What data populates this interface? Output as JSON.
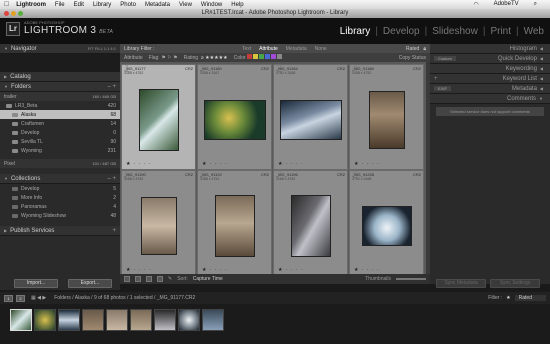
{
  "menubar": {
    "app": "Lightroom",
    "items": [
      "File",
      "Edit",
      "Library",
      "Photo",
      "Metadata",
      "View",
      "Window",
      "Help"
    ],
    "right_label": "AdobeTV"
  },
  "window": {
    "title": "LR#1TEST.lrcat - Adobe Photoshop Lightroom - Library"
  },
  "brand": {
    "logo": "Lr",
    "sub": "ADOBE PHOTOSHOP",
    "name": "LIGHTROOM 3",
    "beta": "BETA"
  },
  "modules": [
    "Library",
    "Develop",
    "Slideshow",
    "Print",
    "Web"
  ],
  "left_panel": {
    "navigator": {
      "label": "Navigator",
      "zoom": "FIT  FILL  1:1  4:1"
    },
    "catalog": {
      "label": "Catalog"
    },
    "folders": {
      "label": "Folders",
      "volume": {
        "name": "trailer",
        "size": "160 / 465 GB"
      },
      "items": [
        {
          "name": "LR3_Beta",
          "count": "420",
          "selected": false
        },
        {
          "name": "Alaska",
          "count": "68",
          "selected": true
        },
        {
          "name": "Craftsmen",
          "count": "14",
          "selected": false
        },
        {
          "name": "Develop",
          "count": "0",
          "selected": false
        },
        {
          "name": "Sevilla TL",
          "count": "90",
          "selected": false
        },
        {
          "name": "Wyoming",
          "count": "231",
          "selected": false
        }
      ],
      "volume2": {
        "name": "Pixel",
        "size": "101 / 487 GB"
      }
    },
    "collections": {
      "label": "Collections",
      "items": [
        {
          "name": "Develop",
          "count": "5"
        },
        {
          "name": "More Info",
          "count": "2"
        },
        {
          "name": "Panoramas",
          "count": "4"
        },
        {
          "name": "Wyoming Slideshow",
          "count": "48"
        }
      ]
    },
    "publish": {
      "label": "Publish Services"
    },
    "buttons": {
      "import": "Import...",
      "export": "Export..."
    }
  },
  "filter": {
    "title": "Library Filter :",
    "tabs": [
      "Text",
      "Attribute",
      "Metadata",
      "None"
    ],
    "preset": "Rated",
    "row": {
      "attribute": "Attribute",
      "flag": "Flag",
      "rating": "Rating",
      "color": "Color",
      "copy": "Copy Status"
    },
    "colors": [
      "#c43c3c",
      "#d8c43c",
      "#4aa44a",
      "#4a6ad8",
      "#a44ad8",
      "#888888"
    ]
  },
  "grid": {
    "cells": [
      {
        "num": "1",
        "name": "_MG_91177",
        "ext": "CR2",
        "size": "3168 x 4752",
        "stars": "★ · · · ·",
        "selected": true
      },
      {
        "num": "2",
        "name": "_MG_91180",
        "ext": "CR2",
        "size": "3168 x 3167",
        "stars": "★ · · · ·",
        "selected": false
      },
      {
        "num": "3",
        "name": "_MG_91184",
        "ext": "CR2",
        "size": "4752 x 3168",
        "stars": "★ · · · ·",
        "selected": false
      },
      {
        "num": "4",
        "name": "_MG_91188",
        "ext": "CR2",
        "size": "3168 x 4752",
        "stars": "★ · · · ·",
        "selected": false
      },
      {
        "num": "5",
        "name": "_MG_91190",
        "ext": "CR2",
        "size": "3168 x 4752",
        "stars": "★ · · · ·",
        "selected": false
      },
      {
        "num": "6",
        "name": "_MG_91192",
        "ext": "CR2",
        "size": "3168 x 4752",
        "stars": "★ · · · ·",
        "selected": false
      },
      {
        "num": "7",
        "name": "_MG_91196",
        "ext": "CR2",
        "size": "3168 x 4752",
        "stars": "★ · · · ·",
        "selected": false
      },
      {
        "num": "8",
        "name": "_MG_91205",
        "ext": "CR2",
        "size": "4752 x 3168",
        "stars": "★ · · · ·",
        "selected": false
      }
    ]
  },
  "toolbar": {
    "sort_label": "Sort:",
    "sort_value": "Capture Time",
    "thumbs": "Thumbnails"
  },
  "right_panel": {
    "histogram": "Histogram",
    "quick_develop": {
      "label": "Quick Develop",
      "preset": "Custom"
    },
    "keywording": "Keywording",
    "keyword_list": "Keyword List",
    "metadata": {
      "label": "Metadata",
      "preset": "EXIF"
    },
    "comments": {
      "label": "Comments",
      "note": "Selected service does not support comments"
    },
    "buttons": {
      "sync_meta": "Sync Metadata",
      "sync_settings": "Sync Settings"
    }
  },
  "filmstrip_bar": {
    "pages": [
      "1",
      "2"
    ],
    "path": "Folders / Alaska / 9 of 68 photos / 1 selected / _MG_91177.CR2",
    "filter_label": "Filter :",
    "filter_value": "Rated"
  },
  "filmstrip": {
    "count": 9
  }
}
